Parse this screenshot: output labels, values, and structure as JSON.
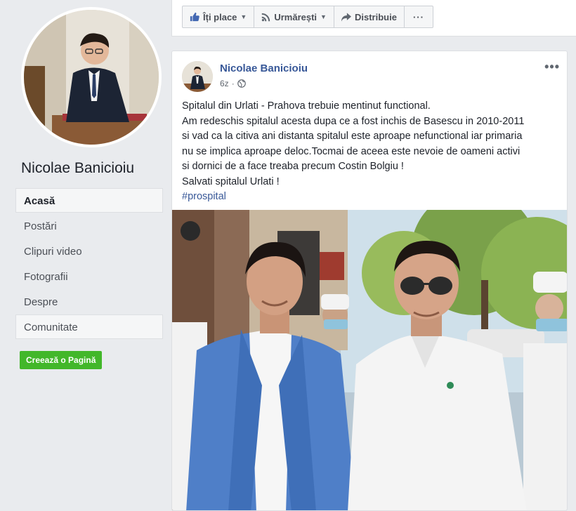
{
  "page": {
    "name": "Nicolae Banicioiu"
  },
  "nav": {
    "items": [
      {
        "label": "Acasă"
      },
      {
        "label": "Postări"
      },
      {
        "label": "Clipuri video"
      },
      {
        "label": "Fotografii"
      },
      {
        "label": "Despre"
      },
      {
        "label": "Comunitate"
      }
    ],
    "create_label": "Creează o Pagină"
  },
  "actions": {
    "like": "Îți place",
    "follow": "Urmărești",
    "share": "Distribuie",
    "more": "···"
  },
  "post": {
    "author": "Nicolae Banicioiu",
    "time": "6z",
    "more": "•••",
    "lines": [
      "Spitalul din Urlati - Prahova trebuie mentinut functional.",
      "Am redeschis spitalul acesta dupa ce a fost inchis de Basescu in 2010-2011",
      "si vad ca la citiva ani distanta spitalul este aproape nefunctional iar primaria",
      "nu se implica aproape deloc.Tocmai de aceea este nevoie de oameni activi",
      "si dornici de a face treaba precum Costin Bolgiu !",
      "Salvati spitalul Urlati !"
    ],
    "hashtag": "#prospital"
  },
  "colors": {
    "link": "#385898",
    "create_button": "#42b72a",
    "background": "#e9ebee"
  }
}
